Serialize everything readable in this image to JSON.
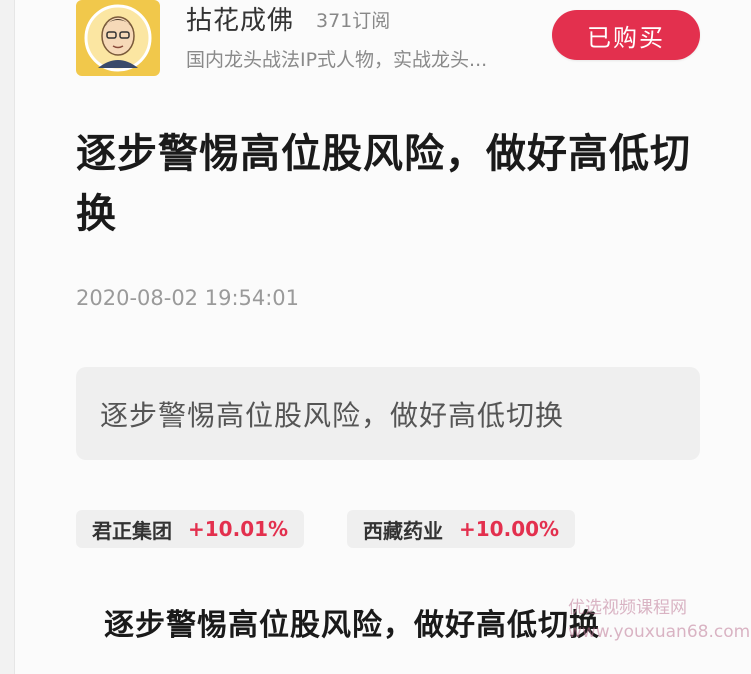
{
  "author": {
    "name": "拈花成佛",
    "subscribers": "371订阅",
    "description": "国内龙头战法IP式人物，实战龙头...",
    "buy_label": "已购买"
  },
  "article": {
    "title": "逐步警惕高位股风险，做好高低切换",
    "timestamp": "2020-08-02 19:54:01",
    "summary": "逐步警惕高位股风险，做好高低切换",
    "body_heading": "逐步警惕高位股风险，做好高低切换"
  },
  "stocks": [
    {
      "name": "君正集团",
      "change": "+10.01%"
    },
    {
      "name": "西藏药业",
      "change": "+10.00%"
    }
  ],
  "watermark": {
    "line1": "优选视频课程网",
    "line2": "www.youxuan68.com"
  },
  "colors": {
    "accent": "#e3304e",
    "avatar_bg": "#f1c84b"
  },
  "icons": {
    "avatar": "cartoon-portrait-icon"
  }
}
